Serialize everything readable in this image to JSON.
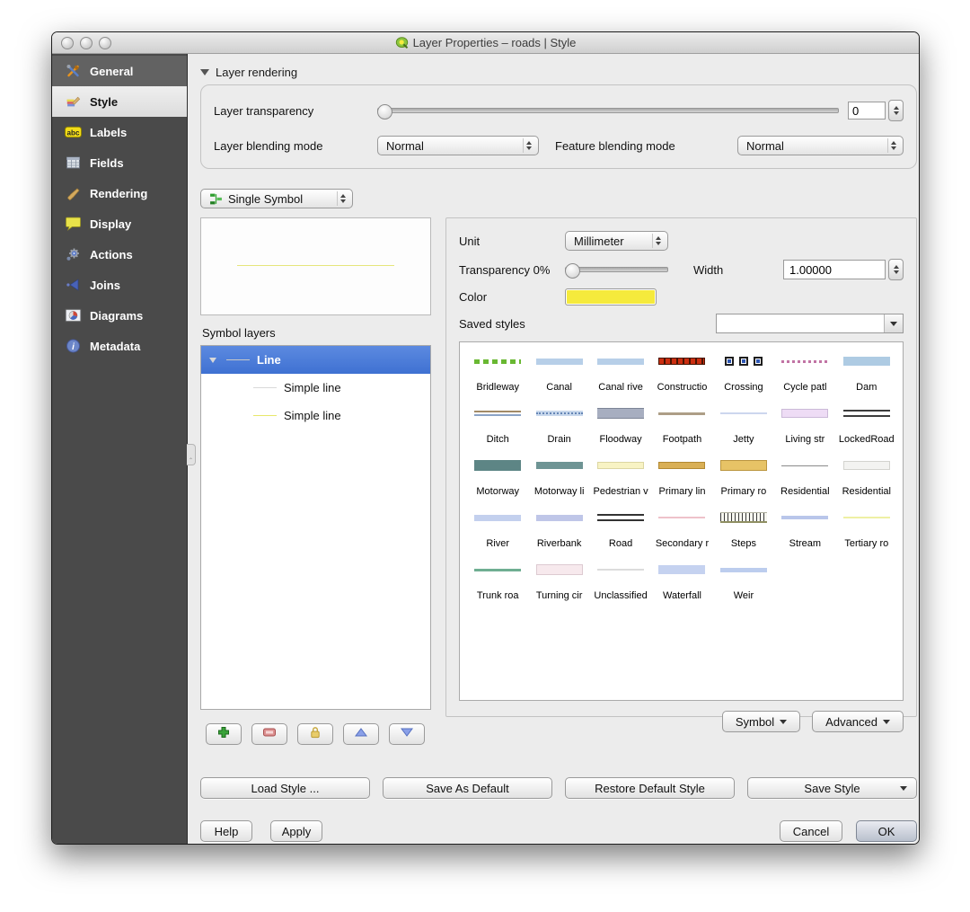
{
  "window": {
    "title": "Layer Properties – roads | Style"
  },
  "sidebar": {
    "items": [
      {
        "label": "General",
        "icon": "general-icon"
      },
      {
        "label": "Style",
        "icon": "style-icon",
        "selected": true
      },
      {
        "label": "Labels",
        "icon": "labels-icon"
      },
      {
        "label": "Fields",
        "icon": "fields-icon"
      },
      {
        "label": "Rendering",
        "icon": "rendering-icon"
      },
      {
        "label": "Display",
        "icon": "display-icon"
      },
      {
        "label": "Actions",
        "icon": "actions-icon"
      },
      {
        "label": "Joins",
        "icon": "joins-icon"
      },
      {
        "label": "Diagrams",
        "icon": "diagrams-icon"
      },
      {
        "label": "Metadata",
        "icon": "metadata-icon"
      }
    ]
  },
  "layer_rendering": {
    "section_label": "Layer rendering",
    "transparency_label": "Layer transparency",
    "transparency_value": "0",
    "layer_blending_label": "Layer blending mode",
    "layer_blending_value": "Normal",
    "feature_blending_label": "Feature blending mode",
    "feature_blending_value": "Normal"
  },
  "symbol": {
    "type_selector_value": "Single Symbol",
    "preview_line_color": "#e6e67c",
    "symbol_layers_label": "Symbol layers",
    "tree": [
      {
        "label": "Line",
        "level": 0,
        "selected": true,
        "line_color": "#c8c8c8"
      },
      {
        "label": "Simple line",
        "level": 1,
        "selected": false,
        "line_color": "#d9d9d9"
      },
      {
        "label": "Simple line",
        "level": 1,
        "selected": false,
        "line_color": "#e8e86a"
      }
    ],
    "layer_buttons": [
      "add",
      "remove",
      "lock",
      "move-up",
      "move-down"
    ],
    "unit_label": "Unit",
    "unit_value": "Millimeter",
    "transparency_label": "Transparency 0%",
    "width_label": "Width",
    "width_value": "1.00000",
    "color_label": "Color",
    "color_value": "#f5ea3c",
    "saved_styles_label": "Saved styles",
    "saved_styles_value": "",
    "symbol_menu_label": "Symbol",
    "advanced_menu_label": "Advanced"
  },
  "styles": [
    {
      "label": "Bridleway",
      "type": "dashes",
      "color": "#69b832",
      "height": 5,
      "dash": 6,
      "gap": 4
    },
    {
      "label": "Canal",
      "type": "bar",
      "color": "#b7cfe8",
      "height": 7
    },
    {
      "label": "Canal rive",
      "type": "bar",
      "color": "#b7cfe8",
      "height": 7
    },
    {
      "label": "Constructio",
      "type": "dashes2",
      "color": "#cc2e10",
      "edge": "#471503",
      "height": 8
    },
    {
      "label": "Crossing",
      "type": "squares",
      "border": "#1e1e1e",
      "center": "#2d56b4"
    },
    {
      "label": "Cycle patl",
      "type": "dashes",
      "color": "#c173a4",
      "height": 3,
      "dash": 3,
      "gap": 3
    },
    {
      "label": "Dam",
      "type": "bar",
      "color": "#aecbe3",
      "height": 10
    },
    {
      "label": "Ditch",
      "type": "twotone",
      "top": "#a28a66",
      "bottom": "#8ba3c6",
      "height": 6
    },
    {
      "label": "Drain",
      "type": "dotline",
      "base": "#c8d8ec",
      "dot": "#6586b6"
    },
    {
      "label": "Floodway",
      "type": "bar3",
      "color": "#a7aec0",
      "edge": "#7c8496",
      "height": 12
    },
    {
      "label": "Footpath",
      "type": "bar",
      "color": "#ad9e86",
      "height": 3
    },
    {
      "label": "Jetty",
      "type": "bar",
      "color": "#ccd6ee",
      "height": 2
    },
    {
      "label": "Living str",
      "type": "barb",
      "color": "#eedcf5",
      "edge": "#cbb9d8",
      "height": 10
    },
    {
      "label": "LockedRoad",
      "type": "double",
      "color": "#3c3c3c",
      "height": 8
    },
    {
      "label": "Motorway",
      "type": "bar",
      "color": "#5d8585",
      "height": 12
    },
    {
      "label": "Motorway li",
      "type": "bar",
      "color": "#6e9494",
      "height": 8
    },
    {
      "label": "Pedestrian v",
      "type": "barb",
      "color": "#f8f3c4",
      "edge": "#dcd6a2",
      "height": 8
    },
    {
      "label": "Primary lin",
      "type": "barb",
      "color": "#d9af55",
      "edge": "#b28932",
      "height": 8
    },
    {
      "label": "Primary ro",
      "type": "barb",
      "color": "#e7c366",
      "edge": "#bb953e",
      "height": 12
    },
    {
      "label": "Residential",
      "type": "bar",
      "color": "#8a8a8a",
      "height": 1
    },
    {
      "label": "Residential",
      "type": "barb",
      "color": "#f3f3f1",
      "edge": "#d3d3cf",
      "height": 10
    },
    {
      "label": "River",
      "type": "bar",
      "color": "#c3d0ee",
      "height": 7
    },
    {
      "label": "Riverbank",
      "type": "bar",
      "color": "#bfc6e8",
      "height": 7
    },
    {
      "label": "Road",
      "type": "double",
      "color": "#333333",
      "height": 8
    },
    {
      "label": "Secondary r",
      "type": "bar",
      "color": "#eec2ca",
      "height": 2
    },
    {
      "label": "Steps",
      "type": "steps"
    },
    {
      "label": "Stream",
      "type": "bar",
      "color": "#b9c6ea",
      "height": 4
    },
    {
      "label": "Tertiary ro",
      "type": "bar",
      "color": "#eef0a4",
      "height": 2
    },
    {
      "label": "Trunk roa",
      "type": "bar",
      "color": "#6fae92",
      "height": 3
    },
    {
      "label": "Turning cir",
      "type": "barb",
      "color": "#f7e9ed",
      "edge": "#ddcad1",
      "height": 12
    },
    {
      "label": "Unclassified",
      "type": "bar",
      "color": "#dcdcdc",
      "height": 2
    },
    {
      "label": "Waterfall",
      "type": "bar",
      "color": "#c5d2f0",
      "height": 10
    },
    {
      "label": "Weir",
      "type": "bar",
      "color": "#bccdee",
      "height": 5
    }
  ],
  "footer": {
    "load_style": "Load Style ...",
    "save_as_default": "Save As Default",
    "restore_default": "Restore Default Style",
    "save_style": "Save Style",
    "help": "Help",
    "apply": "Apply",
    "cancel": "Cancel",
    "ok": "OK"
  }
}
